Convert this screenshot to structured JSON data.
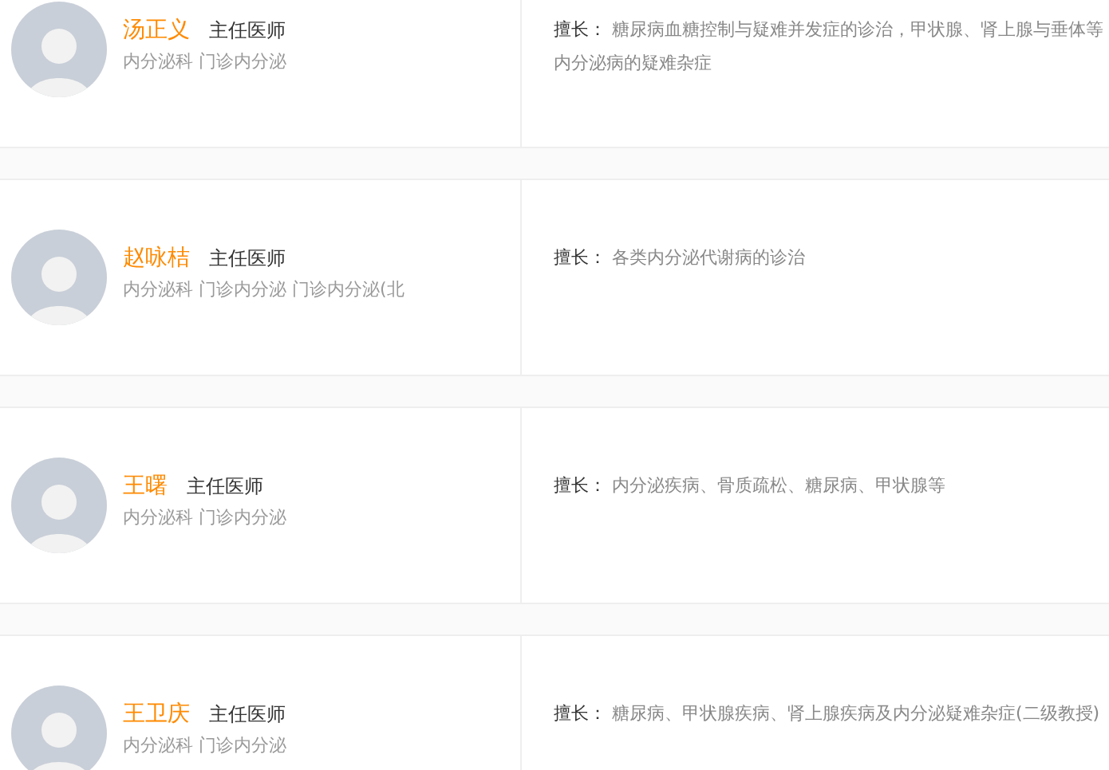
{
  "doctors": [
    {
      "name": "汤正义",
      "title": "主任医师",
      "departments": "内分泌科 门诊内分泌",
      "specialty_label": "擅长：",
      "specialty": "糖尿病血糖控制与疑难并发症的诊治，甲状腺、肾上腺与垂体等内分泌病的疑难杂症"
    },
    {
      "name": "赵咏桔",
      "title": "主任医师",
      "departments": "内分泌科 门诊内分泌 门诊内分泌(北",
      "specialty_label": "擅长：",
      "specialty": "各类内分泌代谢病的诊治"
    },
    {
      "name": "王曙",
      "title": "主任医师",
      "departments": "内分泌科 门诊内分泌",
      "specialty_label": "擅长：",
      "specialty": "内分泌疾病、骨质疏松、糖尿病、甲状腺等"
    },
    {
      "name": "王卫庆",
      "title": "主任医师",
      "departments": "内分泌科 门诊内分泌",
      "specialty_label": "擅长：",
      "specialty": "糖尿病、甲状腺疾病、肾上腺疾病及内分泌疑难杂症(二级教授)"
    }
  ]
}
